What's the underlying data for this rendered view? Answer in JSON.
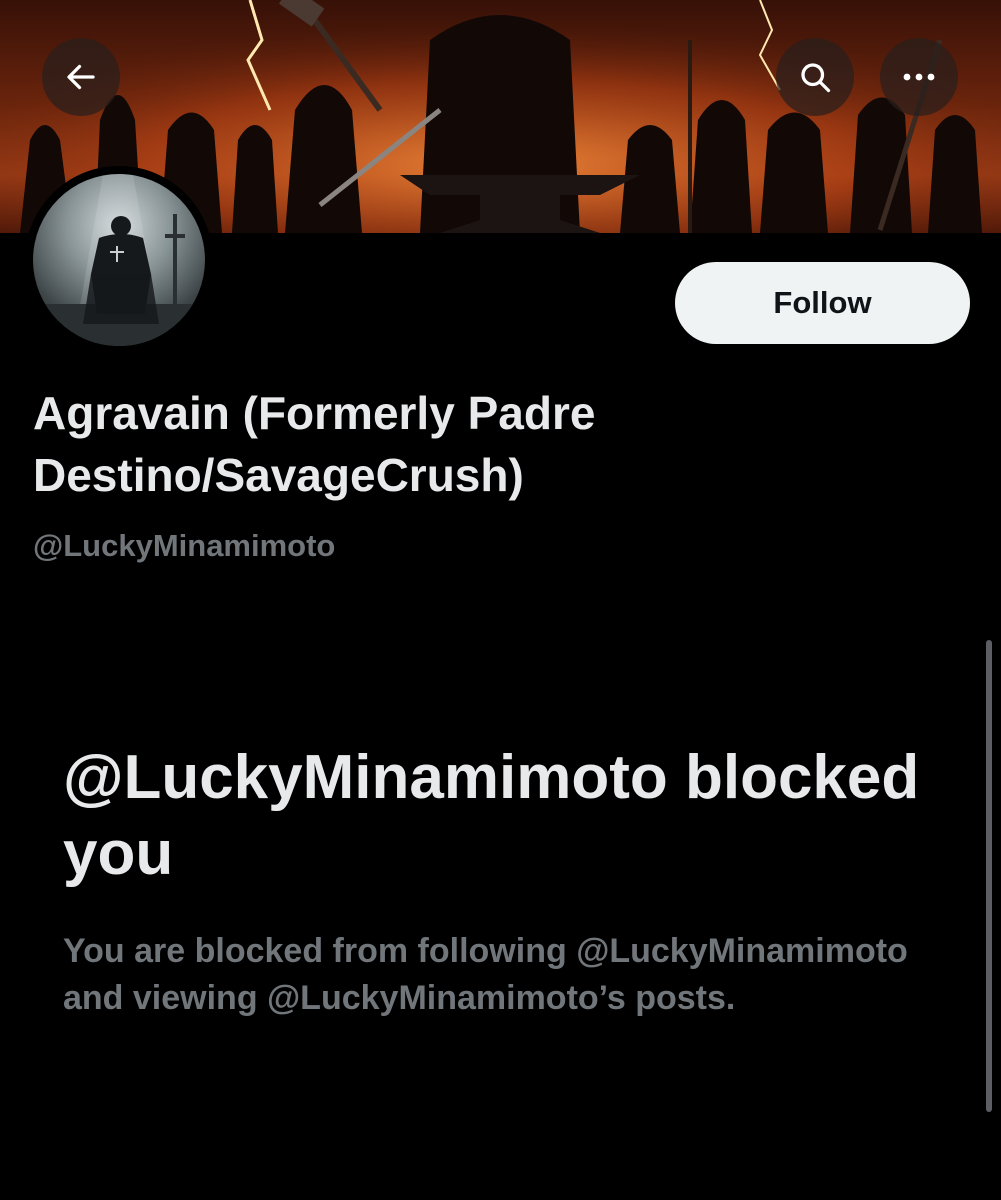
{
  "header": {
    "back_icon": "arrow-left-icon",
    "search_icon": "search-icon",
    "more_icon": "more-horizontal-icon"
  },
  "profile": {
    "display_name": "Agravain (Formerly Padre Destino/SavageCrush)",
    "handle": "@LuckyMinamimoto",
    "follow_label": "Follow"
  },
  "blocked": {
    "title": "@LuckyMinamimoto blocked you",
    "description": "You are blocked from following @LuckyMinamimoto and viewing @LuckyMinamimoto’s posts."
  },
  "colors": {
    "background": "#000000",
    "primary_text": "#e7e9ea",
    "secondary_text": "#71767b",
    "follow_button_bg": "#eff3f4"
  }
}
